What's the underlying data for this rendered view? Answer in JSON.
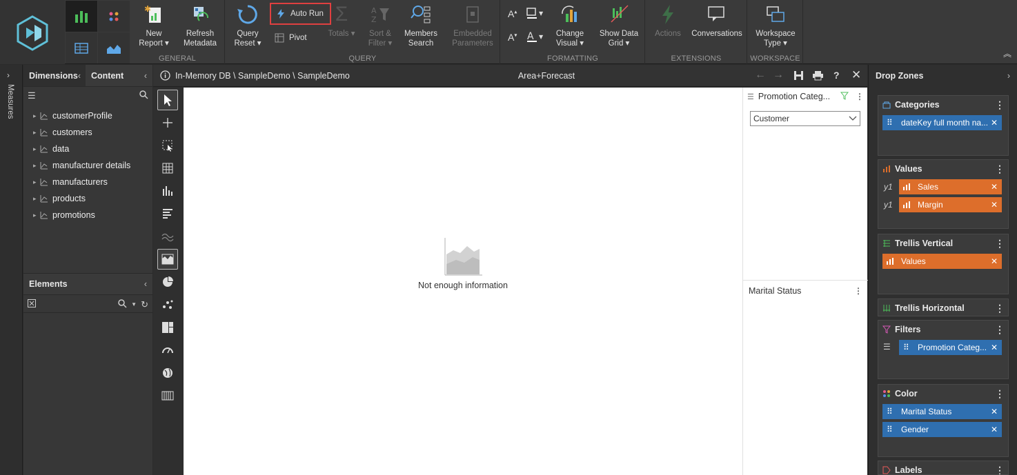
{
  "ribbon": {
    "general": {
      "label": "GENERAL",
      "new_report": "New\nReport ▾",
      "refresh_metadata": "Refresh\nMetadata"
    },
    "query": {
      "label": "QUERY",
      "query_reset": "Query\nReset ▾",
      "auto_run": "Auto Run",
      "pivot": "Pivot",
      "totals": "Totals ▾",
      "sort_filter": "Sort &\nFilter ▾",
      "members_search": "Members\nSearch",
      "embedded_parameters": "Embedded\nParameters"
    },
    "formatting": {
      "label": "FORMATTING",
      "change_visual": "Change\nVisual ▾",
      "show_data_grid": "Show Data\nGrid ▾"
    },
    "extensions": {
      "label": "EXTENSIONS",
      "actions": "Actions",
      "conversations": "Conversations"
    },
    "workspace": {
      "label": "WORKSPACE",
      "workspace_type": "Workspace\nType ▾"
    }
  },
  "left": {
    "measures_label": "Measures",
    "tabs": {
      "dimensions": "Dimensions",
      "content": "Content"
    },
    "dimensions": [
      "customerProfile",
      "customers",
      "data",
      "manufacturer details",
      "manufacturers",
      "products",
      "promotions"
    ],
    "elements_label": "Elements"
  },
  "center": {
    "breadcrumb": "In-Memory DB \\ SampleDemo \\ SampleDemo",
    "report_title": "Area+Forecast",
    "empty_message": "Not enough information",
    "filter1": {
      "title": "Promotion Categ...",
      "selected": "Customer"
    },
    "filter2": {
      "title": "Marital Status"
    }
  },
  "dropzones": {
    "title": "Drop Zones",
    "categories": {
      "label": "Categories",
      "chips": [
        "dateKey full month na..."
      ]
    },
    "values": {
      "label": "Values",
      "axis": "y1",
      "chips": [
        "Sales",
        "Margin"
      ]
    },
    "trellis_vertical": {
      "label": "Trellis Vertical",
      "chips": [
        "Values"
      ]
    },
    "trellis_horizontal": {
      "label": "Trellis Horizontal"
    },
    "filters": {
      "label": "Filters",
      "chips": [
        "Promotion Categ..."
      ]
    },
    "color": {
      "label": "Color",
      "chips": [
        "Marital Status",
        "Gender"
      ]
    },
    "labels": {
      "label": "Labels"
    }
  },
  "colors": {
    "accent_blue": "#2f6fb0",
    "accent_orange": "#dd6e2b",
    "highlight_red": "#e04040"
  }
}
